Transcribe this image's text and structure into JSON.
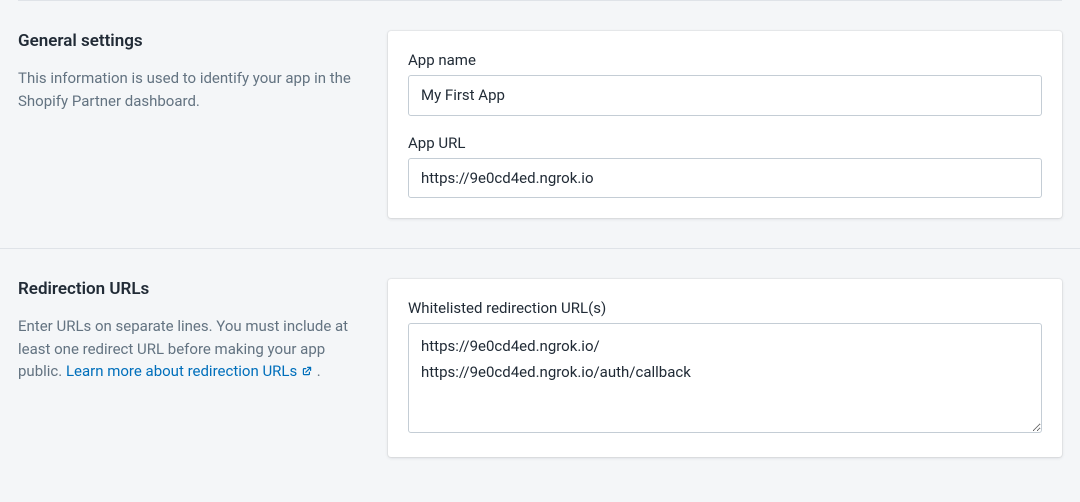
{
  "general": {
    "heading": "General settings",
    "description": "This information is used to identify your app in the Shopify Partner dashboard.",
    "app_name_label": "App name",
    "app_name_value": "My First App",
    "app_url_label": "App URL",
    "app_url_value": "https://9e0cd4ed.ngrok.io"
  },
  "redirection": {
    "heading": "Redirection URLs",
    "description_prefix": "Enter URLs on separate lines. You must include at least one redirect URL before making your app public. ",
    "link_text": "Learn more about redirection URLs",
    "description_suffix": " .",
    "whitelist_label": "Whitelisted redirection URL(s)",
    "whitelist_value": "https://9e0cd4ed.ngrok.io/\nhttps://9e0cd4ed.ngrok.io/auth/callback"
  }
}
